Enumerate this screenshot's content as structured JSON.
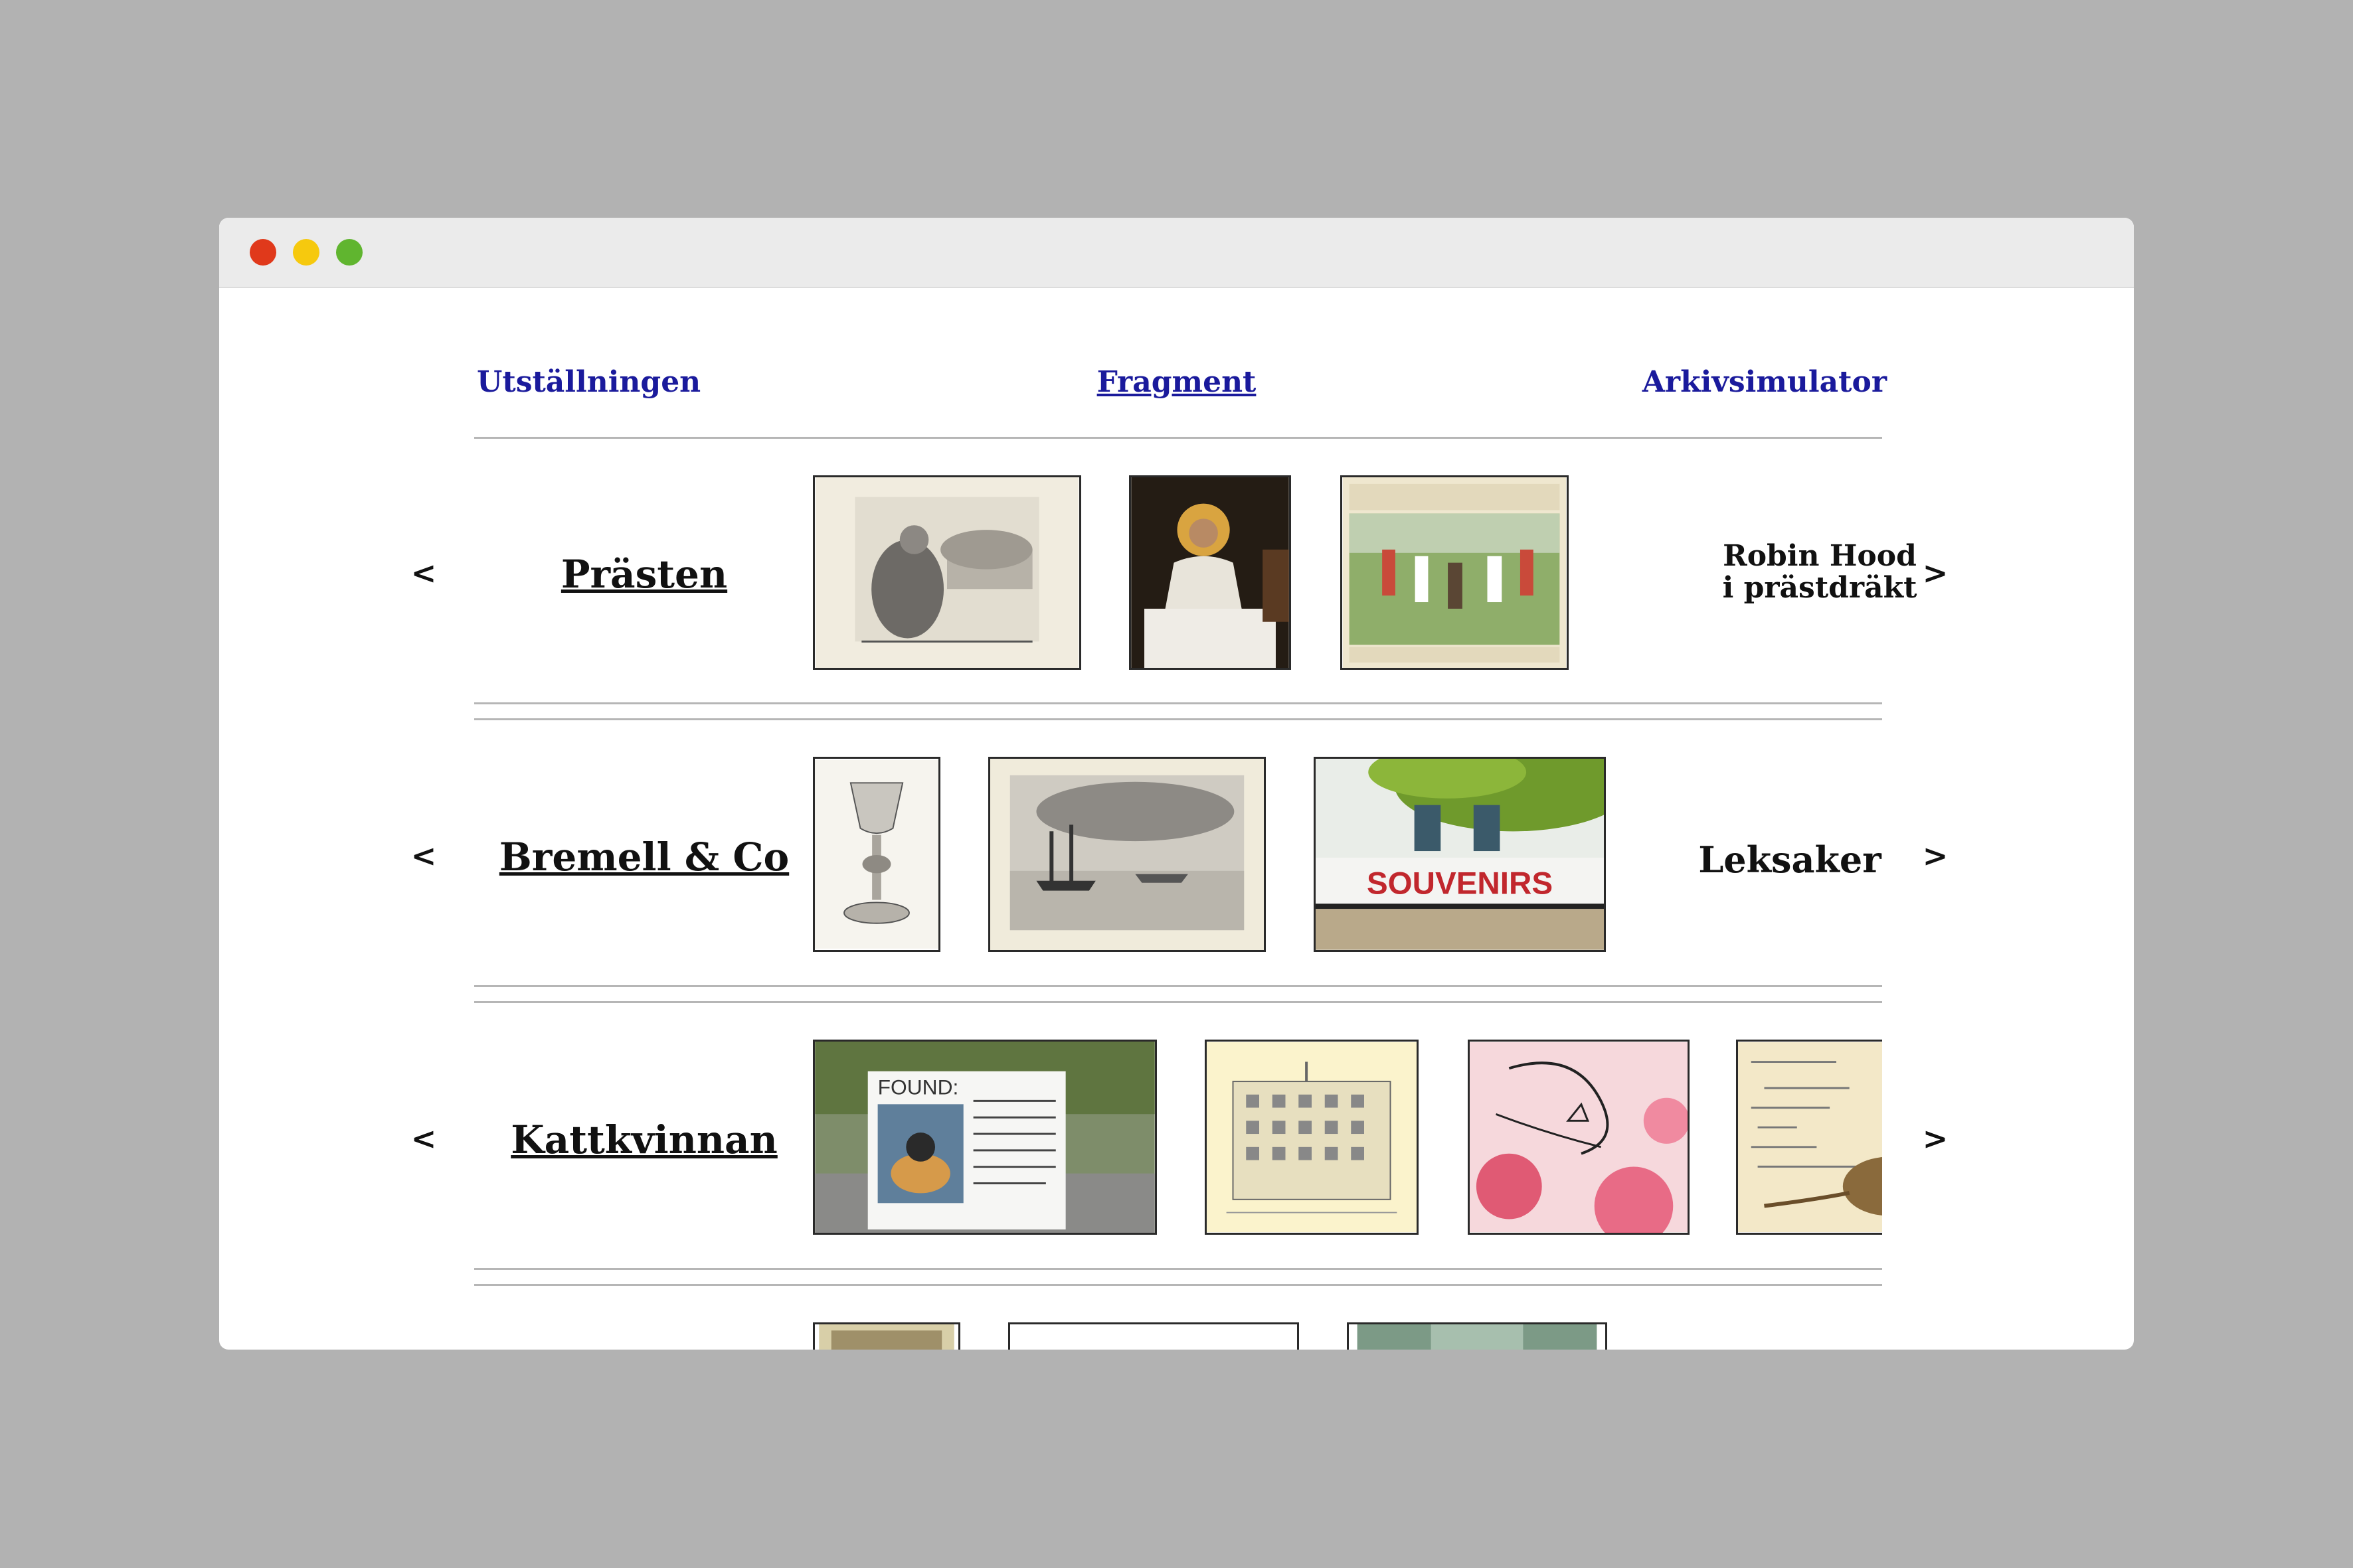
{
  "window": {
    "controls": [
      "close",
      "minimize",
      "maximize"
    ]
  },
  "nav": {
    "left": "Utställningen",
    "center": "Fragment",
    "right": "Arkivsimulator"
  },
  "rows": [
    {
      "title": "Prästen",
      "side_line1": "Robin Hood",
      "side_line2": "i prästdräkt",
      "prev": "<",
      "next": ">",
      "thumbnails": [
        "kneeling-figure-engraving",
        "christ-at-table-painting",
        "illuminated-manuscript-procession"
      ]
    },
    {
      "title": "Bremell & Co",
      "side": "Leksaker",
      "prev": "<",
      "next": ">",
      "thumbnails": [
        "chalice-engraving",
        "ships-in-harbor-engraving",
        "souvenirs-shop-sign-photo"
      ],
      "sign_text": "SOUVENIRS"
    },
    {
      "title": "Kattkvinnan",
      "side": "",
      "prev": "<",
      "next": ">",
      "thumbnails": [
        "found-cat-poster-photo",
        "hotel-building-engraving",
        "pink-cat-embroidery",
        "cat-poem-book-page"
      ],
      "poster_heading": "FOUND:"
    }
  ],
  "colors": {
    "link_blue": "#1a1a9c",
    "background_grey": "#b2b2b2",
    "close": "#e0391b",
    "minimize": "#f6c90e",
    "maximize": "#60b52f"
  }
}
